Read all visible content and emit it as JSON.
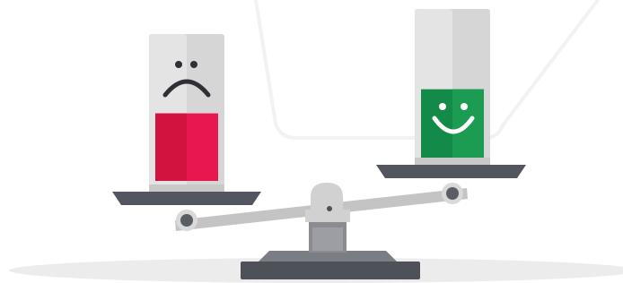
{
  "illustration": {
    "icons": {
      "left_face": "sad-face-icon",
      "right_face": "happy-face-icon"
    },
    "levels": {
      "left_glass_fill": 0.46,
      "right_glass_fill": 0.46
    },
    "colors": {
      "background": "#ffffff",
      "background_line": "#f2f2f2",
      "floor_shadow": "#ececec",
      "glass": "#d6d6d6",
      "glass_highlight": "#e4e4e4",
      "glass_base": "#c9c9c9",
      "red_liquid": "#e8174f",
      "red_liquid_dark": "#d2123f",
      "green_liquid": "#138a47",
      "green_liquid_light": "#1c9c52",
      "face_dark": "#2f2f35",
      "face_light": "#ffffff",
      "pan": "#54565f",
      "beam": "#c4c4c4",
      "pivot": "#d1d1d1",
      "stand": "#8a8c92",
      "base": "#4f5158"
    }
  }
}
